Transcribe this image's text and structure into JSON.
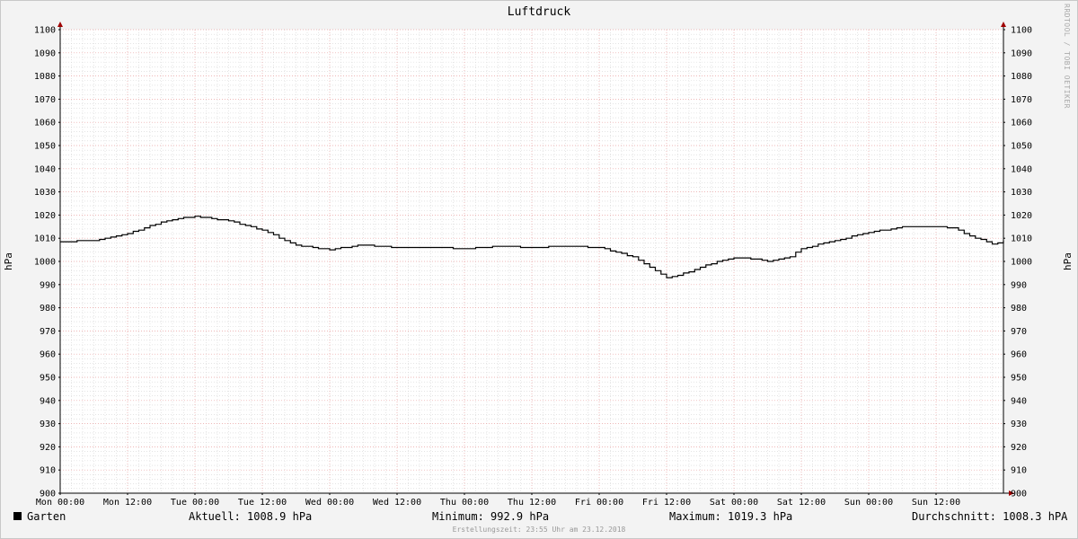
{
  "chart_data": {
    "type": "line",
    "title": "Luftdruck",
    "ylabel": "hPa",
    "ylabel_right": "hPa",
    "ylim": [
      900,
      1100
    ],
    "y_ticks": [
      900,
      910,
      920,
      930,
      940,
      950,
      960,
      970,
      980,
      990,
      1000,
      1010,
      1020,
      1030,
      1040,
      1050,
      1060,
      1070,
      1080,
      1090,
      1100
    ],
    "x_ticks": [
      "Mon 00:00",
      "Mon 12:00",
      "Tue 00:00",
      "Tue 12:00",
      "Wed 00:00",
      "Wed 12:00",
      "Thu 00:00",
      "Thu 12:00",
      "Fri 00:00",
      "Fri 12:00",
      "Sat 00:00",
      "Sat 12:00",
      "Sun 00:00",
      "Sun 12:00"
    ],
    "x_unit": "hours since Mon 00:00",
    "grid": true,
    "series": [
      {
        "name": "Garten",
        "color": "#000000",
        "x": [
          0,
          6,
          12,
          18,
          22,
          24,
          26,
          30,
          36,
          40,
          42,
          46,
          48,
          50,
          54,
          56,
          60,
          66,
          72,
          74,
          78,
          84,
          90,
          96,
          102,
          108,
          112,
          114,
          118,
          120,
          124,
          126,
          130,
          132,
          138,
          144,
          150,
          156,
          159,
          162,
          166,
          168
        ],
        "values": [
          1008.5,
          1009.0,
          1012.0,
          1017.0,
          1019.0,
          1019.3,
          1018.8,
          1017.5,
          1013.5,
          1009.0,
          1007.0,
          1005.5,
          1005.0,
          1005.8,
          1007.2,
          1006.5,
          1006.0,
          1006.0,
          1005.5,
          1005.8,
          1006.5,
          1006.0,
          1006.5,
          1006.0,
          1002.0,
          992.9,
          995.5,
          997.5,
          1000.5,
          1001.5,
          1001.0,
          1000.0,
          1002.0,
          1005.5,
          1009.0,
          1012.5,
          1014.8,
          1014.9,
          1014.5,
          1011.0,
          1007.5,
          1008.9
        ]
      }
    ]
  },
  "legend": {
    "series_name": "Garten",
    "current": "Aktuell: 1008.9 hPa",
    "minimum": "Minimum: 992.9 hPa",
    "maximum": "Maximum: 1019.3 hPa",
    "average": "Durchschnitt: 1008.3 hPA"
  },
  "watermark": "RRDTOOL / TOBI OETIKER",
  "footer": "Erstellungszeit: 23:55 Uhr am 23.12.2018"
}
